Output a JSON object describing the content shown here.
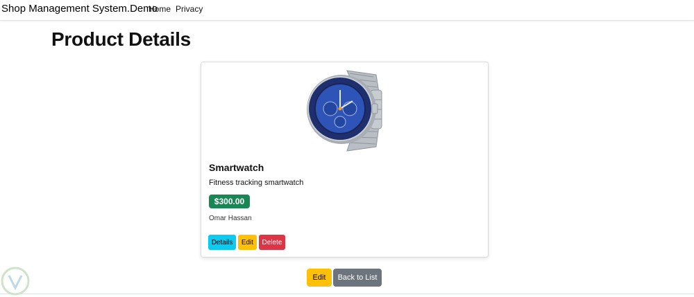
{
  "navbar": {
    "brand": "Shop Management System.Demo",
    "links": [
      "Home",
      "Privacy"
    ]
  },
  "page": {
    "title": "Product Details"
  },
  "product": {
    "name": "Smartwatch",
    "description": "Fitness tracking smartwatch",
    "price": "$300.00",
    "owner": "Omar Hassan",
    "image_icon": "smartwatch-image"
  },
  "card_actions": {
    "details": "Details",
    "edit": "Edit",
    "delete": "Delete"
  },
  "page_actions": {
    "edit": "Edit",
    "back": "Back to List"
  },
  "colors": {
    "success": "#198754",
    "info": "#0dcaf0",
    "warning": "#ffc107",
    "danger": "#dc3545",
    "secondary": "#6c757d"
  }
}
